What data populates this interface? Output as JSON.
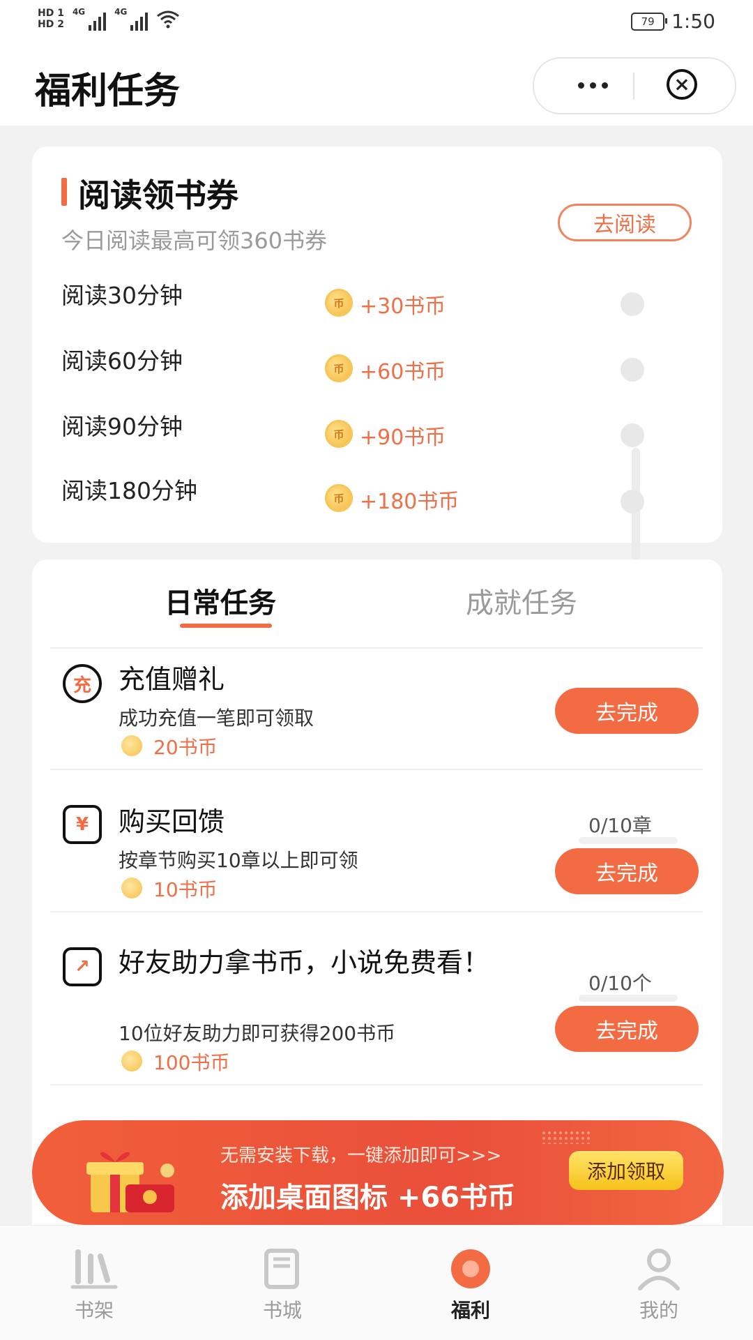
{
  "status_bar": {
    "hd1": "HD 1",
    "hd2": "HD 2",
    "net1": "4G",
    "net2": "4G",
    "battery": "79",
    "time": "1:50"
  },
  "header": {
    "title": "福利任务",
    "more_icon": "more-dots-icon",
    "close_icon": "close-circle-icon"
  },
  "reading": {
    "title": "阅读领书券",
    "subtitle": "今日阅读最高可领360书券",
    "go_button": "去阅读",
    "rows": [
      {
        "label": "阅读30分钟",
        "coin_text": "币",
        "reward": "+30书币"
      },
      {
        "label": "阅读60分钟",
        "coin_text": "币",
        "reward": "+60书币"
      },
      {
        "label": "阅读90分钟",
        "coin_text": "币",
        "reward": "+90书币"
      },
      {
        "label": "阅读180分钟",
        "coin_text": "币",
        "reward": "+180书币"
      }
    ]
  },
  "tasks": {
    "tabs": [
      {
        "label": "日常任务",
        "active": true
      },
      {
        "label": "成就任务",
        "active": false
      }
    ],
    "items": [
      {
        "icon": "recharge-icon",
        "icon_text": "充",
        "title": "充值赠礼",
        "desc": "成功充值一笔即可领取",
        "reward": "20书币",
        "button": "去完成",
        "progress": ""
      },
      {
        "icon": "purchase-icon",
        "icon_text": "¥",
        "title": "购买回馈",
        "desc": "按章节购买10章以上即可领",
        "reward": "10书币",
        "button": "去完成",
        "progress": "0/10章"
      },
      {
        "icon": "share-icon",
        "icon_text": "↗",
        "title": "好友助力拿书币，小说免费看！",
        "desc": "10位好友助力即可获得200书币",
        "reward": "100书币",
        "button": "去完成",
        "progress": "0/10个"
      }
    ]
  },
  "banner": {
    "subtitle": "无需安装下载，一键添加即可>>>",
    "main": "添加桌面图标 +66书币",
    "button": "添加领取",
    "icon": "gift-box-icon"
  },
  "nav": [
    {
      "label": "书架",
      "icon": "bookshelf-icon",
      "active": false
    },
    {
      "label": "书城",
      "icon": "book-store-icon",
      "active": false
    },
    {
      "label": "福利",
      "icon": "welfare-icon",
      "active": true
    },
    {
      "label": "我的",
      "icon": "profile-icon",
      "active": false
    }
  ],
  "colors": {
    "accent": "#f26b43",
    "coin": "#f2b43b",
    "banner": "#e94f3a"
  }
}
